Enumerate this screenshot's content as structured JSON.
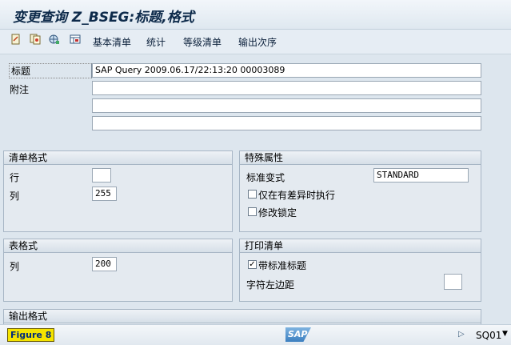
{
  "window": {
    "title": "变更查询 Z_BSEG:标题,格式"
  },
  "toolbar": {
    "icons": [
      "change-doc-icon",
      "copy-doc-icon",
      "globe-settings-icon",
      "layout-icon"
    ],
    "buttons": [
      "基本清单",
      "统计",
      "等级清单",
      "输出次序"
    ]
  },
  "header_fields": {
    "title_label": "标题",
    "title_value": "SAP Query 2009.06.17/22:13:20 00003089",
    "notes_label": "附注",
    "notes": [
      "",
      "",
      ""
    ]
  },
  "list_format": {
    "title": "清单格式",
    "rows_label": "行",
    "rows_value": "",
    "cols_label": "列",
    "cols_value": "255"
  },
  "special_attributes": {
    "title": "特殊属性",
    "variant_label": "标准变式",
    "variant_value": "STANDARD",
    "exec_diff_label": "仅在有差异时执行",
    "exec_diff_checked": false,
    "lock_label": "修改锁定",
    "lock_checked": false
  },
  "table_format": {
    "title": "表格式",
    "cols_label": "列",
    "cols_value": "200"
  },
  "print_list": {
    "title": "打印清单",
    "std_title_label": "带标准标题",
    "std_title_checked": true,
    "left_margin_label": "字符左边距",
    "left_margin_value": ""
  },
  "output_format": {
    "title": "输出格式"
  },
  "statusbar": {
    "figure_label": "Figure 8",
    "logo_text": "SAP",
    "system": "SQ01"
  },
  "colors": {
    "background": "#dde6ee",
    "title_text": "#0d2a4a",
    "badge": "#f5e400"
  }
}
